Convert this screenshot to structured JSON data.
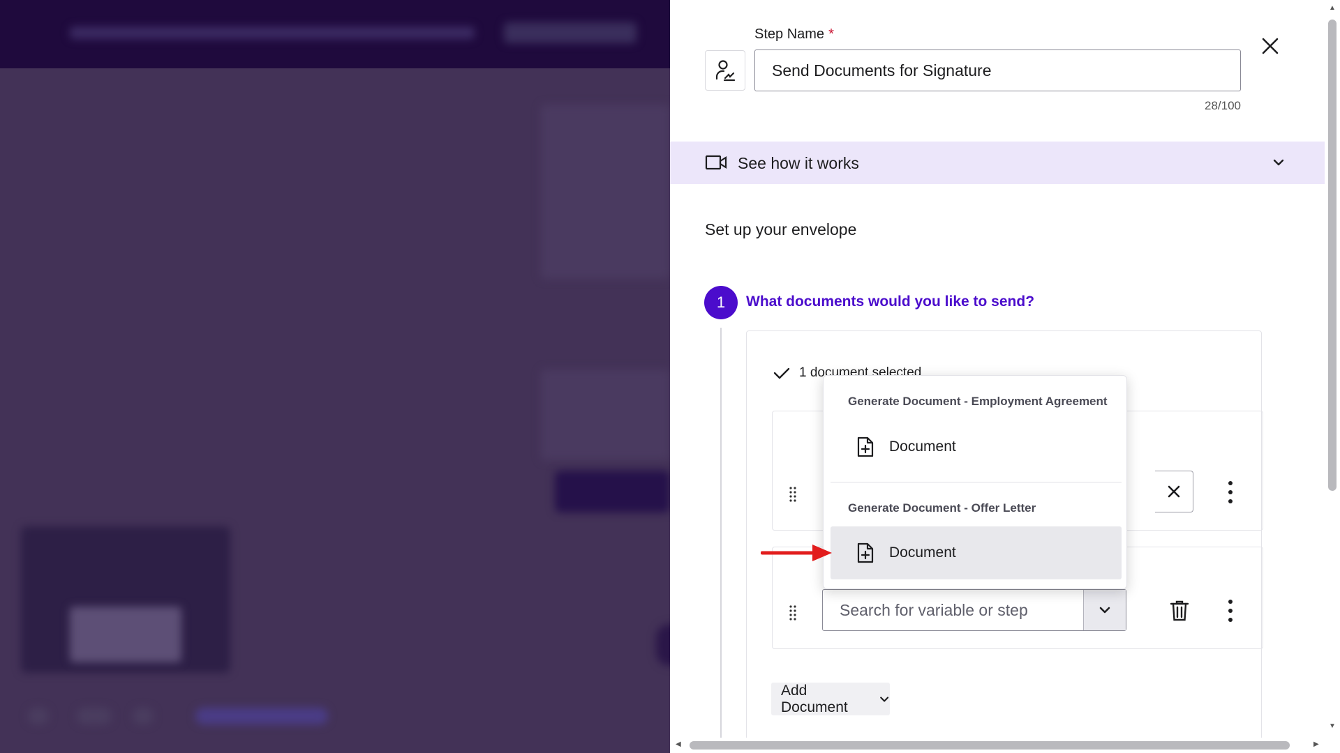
{
  "step": {
    "label": "Step Name",
    "required_mark": "*",
    "name_value": "Send Documents for Signature",
    "counter": "28/100"
  },
  "how_it_works": {
    "label": "See how it works"
  },
  "setup": {
    "title": "Set up your envelope"
  },
  "question": {
    "number": "1",
    "text": "What documents would you like to send?"
  },
  "selection": {
    "summary": "1 document selected"
  },
  "dropdown": {
    "groups": [
      {
        "title": "Generate Document - Employment Agreement",
        "item": "Document"
      },
      {
        "title": "Generate Document - Offer Letter",
        "item": "Document"
      }
    ]
  },
  "search": {
    "placeholder": "Search for variable or step"
  },
  "add_document": {
    "label": "Add Document"
  },
  "colors": {
    "accent": "#4b0ccc",
    "banner": "#ece6fa",
    "arrow": "#e21d1d"
  },
  "icons": {
    "step": "user-signature-icon",
    "close": "close-icon",
    "video": "video-camera-icon",
    "check": "check-icon",
    "doc": "document-plus-icon",
    "trash": "trash-icon"
  }
}
